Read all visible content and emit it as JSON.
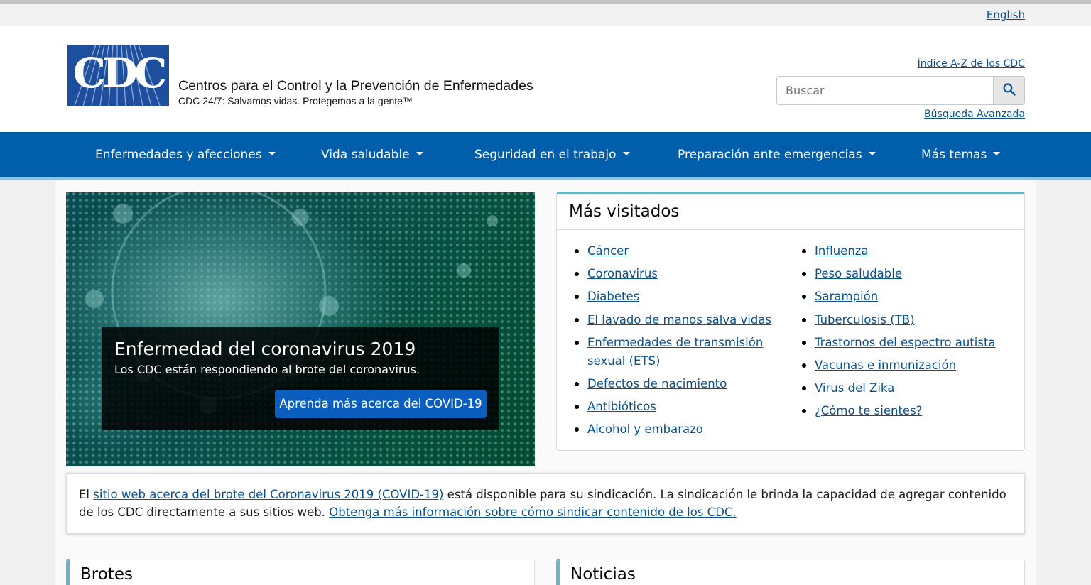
{
  "language_link": "English",
  "header": {
    "logo_text": "CDC",
    "org_name": "Centros para el Control y la Prevención de Enfermedades",
    "tagline": "CDC 24/7: Salvamos vidas. Protegemos a la gente™",
    "az_index_link": "Índice A-Z de los CDC",
    "search_placeholder": "Buscar",
    "search_icon": "search-icon",
    "advanced_search_link": "Búsqueda Avanzada"
  },
  "nav": {
    "items": [
      {
        "label": "Enfermedades y afecciones"
      },
      {
        "label": "Vida saludable"
      },
      {
        "label": "Seguridad en el trabajo"
      },
      {
        "label": "Preparación ante emergencias"
      },
      {
        "label": "Más temas"
      }
    ]
  },
  "hero": {
    "title": "Enfermedad del coronavirus 2019",
    "subtitle": "Los CDC están respondiendo al brote del coronavirus.",
    "button": "Aprenda más acerca del COVID-19"
  },
  "most_visited": {
    "title": "Más visitados",
    "left": [
      "Cáncer",
      "Coronavirus",
      "Diabetes",
      "El lavado de manos salva vidas",
      "Enfermedades de transmisión sexual (ETS)",
      "Defectos de nacimiento",
      "Antibióticos",
      "Alcohol y embarazo"
    ],
    "right": [
      "Influenza",
      "Peso saludable",
      "Sarampión",
      "Tuberculosis (TB)",
      "Trastornos del espectro autista",
      "Vacunas e inmunización",
      "Virus del Zika",
      "¿Cómo te sientes?"
    ]
  },
  "syndication": {
    "prefix": "El ",
    "link1": "sitio web acerca del brote del Coronavirus 2019 (COVID-19)",
    "middle": " está disponible para su sindicación. La sindicación le brinda la capacidad de agregar contenido de los CDC directamente a sus sitios web. ",
    "link2": "Obtenga más información sobre cómo sindicar contenido de los CDC."
  },
  "sections": {
    "outbreaks_title": "Brotes",
    "news_title": "Noticias"
  },
  "colors": {
    "nav_blue": "#005eaa",
    "logo_blue": "#1d4f9e",
    "link_blue": "#075290",
    "accent_teal": "#6cb3c9",
    "button_blue": "#0b5ebe"
  }
}
